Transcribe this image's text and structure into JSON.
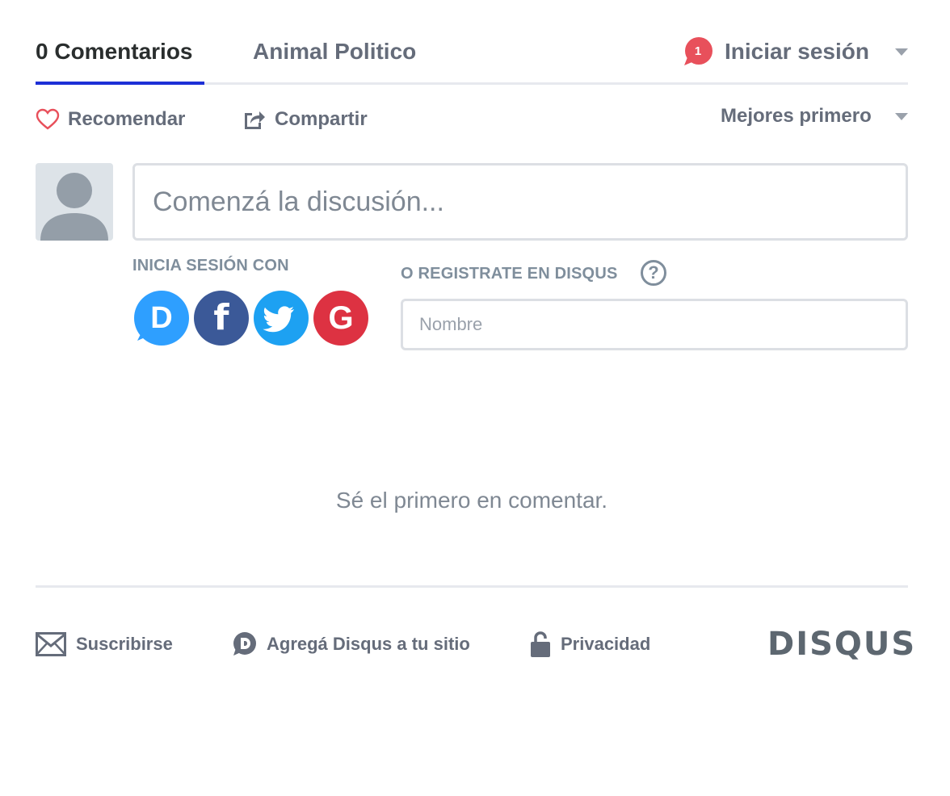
{
  "nav": {
    "comments_tab": "0 Comentarios",
    "community_tab": "Animal Politico",
    "notification_count": "1",
    "login_label": "Iniciar sesión"
  },
  "actions": {
    "recommend": "Recomendar",
    "share": "Compartir",
    "sort": "Mejores primero"
  },
  "composer": {
    "placeholder": "Comenzá la discusión...",
    "login_with_label": "INICIA SESIÓN CON",
    "register_label": "O REGISTRATE EN DISQUS",
    "help_symbol": "?",
    "name_placeholder": "Nombre",
    "social": [
      {
        "name": "Disqus",
        "glyph": "D",
        "color": "#2e9fff"
      },
      {
        "name": "Facebook",
        "glyph": "f",
        "color": "#3b5998"
      },
      {
        "name": "Twitter",
        "glyph": "twitter-bird-icon",
        "color": "#1da1f2"
      },
      {
        "name": "Google",
        "glyph": "G",
        "color": "#dd3242"
      }
    ]
  },
  "empty_message": "Sé el primero en comentar.",
  "footer": {
    "subscribe": "Suscribirse",
    "add_disqus": "Agregá Disqus a tu sitio",
    "privacy": "Privacidad",
    "logo": "DISQUS"
  },
  "colors": {
    "accent_blue": "#1d2fd6",
    "badge_red": "#e8505b",
    "heart_red": "#e8505b",
    "muted_text": "#656c7a"
  }
}
